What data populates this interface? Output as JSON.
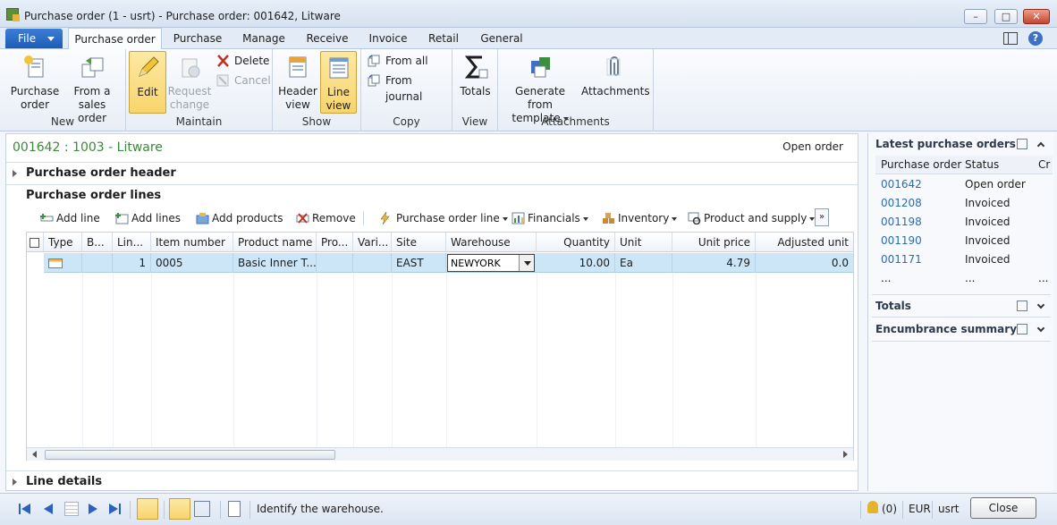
{
  "window": {
    "title": "Purchase order (1 - usrt) - Purchase order: 001642, Litware",
    "min": "–",
    "max": "□",
    "close": "✕"
  },
  "tabs": {
    "file": "File",
    "items": [
      "Purchase order",
      "Purchase",
      "Manage",
      "Receive",
      "Invoice",
      "Retail",
      "General"
    ],
    "help": "?"
  },
  "ribbon": {
    "new": {
      "label": "New",
      "purchase_order": "Purchase order",
      "from_sales_order": "From a sales order"
    },
    "maintain": {
      "label": "Maintain",
      "edit": "Edit",
      "request_change": "Request change",
      "delete": "Delete",
      "cancel": "Cancel"
    },
    "show": {
      "label": "Show",
      "header_view": "Header view",
      "line_view": "Line view"
    },
    "copy": {
      "label": "Copy",
      "from_all": "From all",
      "from_journal": "From journal"
    },
    "view": {
      "label": "View",
      "totals": "Totals"
    },
    "attachments": {
      "label": "Attachments",
      "generate_from_template": "Generate from template",
      "attachments": "Attachments"
    }
  },
  "form": {
    "title": "001642 : 1003 - Litware",
    "status": "Open order",
    "header_tab": "Purchase order header",
    "lines_tab": "Purchase order lines",
    "line_details_tab": "Line details"
  },
  "lines_toolbar": {
    "add_line": "Add line",
    "add_lines": "Add lines",
    "add_products": "Add products",
    "remove": "Remove",
    "po_line": "Purchase order line",
    "financials": "Financials",
    "inventory": "Inventory",
    "product_supply": "Product and supply",
    "more": "»"
  },
  "grid": {
    "columns": [
      "Type",
      "B...",
      "Lin...",
      "Item number",
      "Product name",
      "Pro...",
      "Vari...",
      "Site",
      "Warehouse",
      "Quantity",
      "Unit",
      "Unit price",
      "Adjusted unit"
    ],
    "row": {
      "line": "1",
      "item_number": "0005",
      "product_name": "Basic Inner T...",
      "site": "EAST",
      "warehouse": "NEWYORK",
      "quantity": "10.00",
      "unit": "Ea",
      "unit_price": "4.79",
      "adjusted_unit": "0.0"
    }
  },
  "right_pane": {
    "latest_title": "Latest purchase orders",
    "col_po": "Purchase order",
    "col_status": "Status",
    "col_c": "Cr",
    "rows": [
      {
        "po": "001642",
        "status": "Open order"
      },
      {
        "po": "001208",
        "status": "Invoiced"
      },
      {
        "po": "001198",
        "status": "Invoiced"
      },
      {
        "po": "001190",
        "status": "Invoiced"
      },
      {
        "po": "001171",
        "status": "Invoiced"
      }
    ],
    "more": "...",
    "totals": "Totals",
    "encumbrance": "Encumbrance summary"
  },
  "statusbar": {
    "message": "Identify the warehouse.",
    "notifications": "(0)",
    "currency": "EUR",
    "user": "usrt",
    "close": "Close"
  },
  "colors": {
    "accent": "#1d5cb5",
    "selected_row": "#cde6f7",
    "highlight_button": "#f8d46c",
    "title_green": "#3b8a3b",
    "link": "#2b6cb0"
  }
}
